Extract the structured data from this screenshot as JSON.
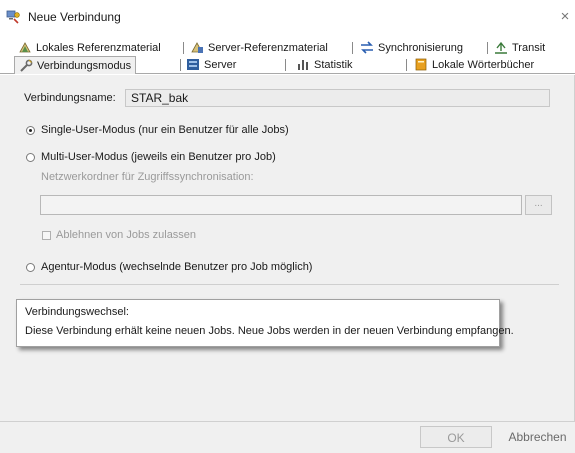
{
  "window": {
    "title": "Neue Verbindung",
    "close_symbol": "×",
    "icon": "connection-icon"
  },
  "tabs": {
    "row1": [
      {
        "label": "Lokales Referenzmaterial",
        "icon": "reference-material-icon"
      },
      {
        "label": "Server-Referenzmaterial",
        "icon": "server-reference-icon"
      },
      {
        "label": "Synchronisierung",
        "icon": "sync-arrows-icon"
      },
      {
        "label": "Transit",
        "icon": "transit-icon"
      }
    ],
    "row2": [
      {
        "label": "Verbindungsmodus",
        "icon": "wrench-icon",
        "active": true
      },
      {
        "label": "Server",
        "icon": "server-icon"
      },
      {
        "label": "Statistik",
        "icon": "statistics-icon"
      },
      {
        "label": "Lokale Wörterbücher",
        "icon": "dictionary-icon"
      }
    ]
  },
  "form": {
    "connection_name_label": "Verbindungsname:",
    "connection_name_value": "STAR_bak",
    "single_user_label": "Single-User-Modus (nur ein Benutzer für alle Jobs)",
    "multi_user_label": "Multi-User-Modus (jeweils ein Benutzer pro Job)",
    "network_folder_label": "Netzwerkordner für Zugriffssynchronisation:",
    "network_folder_value": "",
    "browse_label": "...",
    "reject_jobs_label": "Ablehnen von Jobs zulassen",
    "agent_mode_label": "Agentur-Modus (wechselnde Benutzer pro Job möglich)",
    "selected_mode": "single_user"
  },
  "info": {
    "title": "Verbindungswechsel:",
    "text": "Diese Verbindung erhält keine neuen Jobs. Neue Jobs werden in der neuen Verbindung empfangen."
  },
  "footer": {
    "ok_label": "OK",
    "cancel_label": "Abbrechen"
  },
  "colors": {
    "panel_bg": "#f0f0f0",
    "disabled_text": "#9a9a9a"
  }
}
